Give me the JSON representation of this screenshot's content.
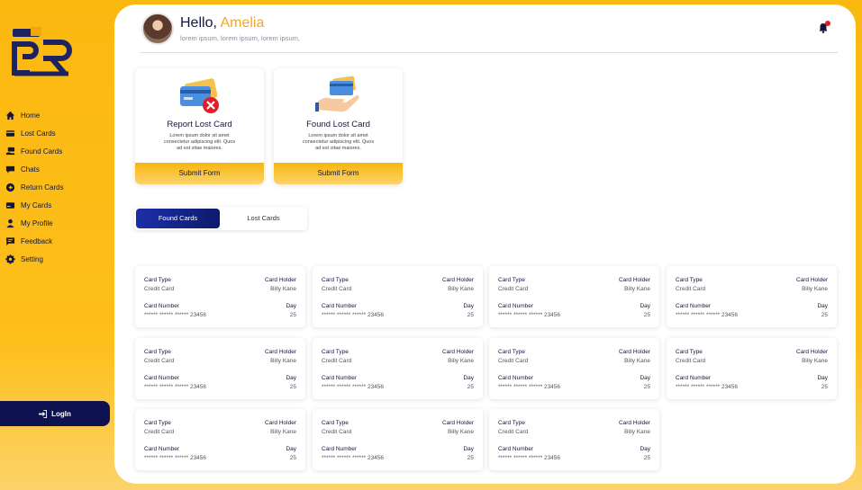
{
  "sidebar": {
    "items": [
      {
        "label": "Home",
        "icon": "home-icon"
      },
      {
        "label": "Lost Cards",
        "icon": "card-icon"
      },
      {
        "label": "Found Cards",
        "icon": "found-card-icon"
      },
      {
        "label": "Chats",
        "icon": "chat-icon"
      },
      {
        "label": "Return Cards",
        "icon": "return-icon"
      },
      {
        "label": "My Cards",
        "icon": "wallet-icon"
      },
      {
        "label": "My Profile",
        "icon": "user-icon"
      },
      {
        "label": "Feedback",
        "icon": "feedback-icon"
      },
      {
        "label": "Setting",
        "icon": "gear-icon"
      }
    ],
    "login_label": "LogIn"
  },
  "header": {
    "greeting": "Hello, ",
    "name": "Amelia",
    "subtitle": "lorem ipsum, lorem ipsum, lorem ipsum,"
  },
  "actions": [
    {
      "title": "Report Lost Card",
      "desc": "Lorem ipsum dolor sit amet consectetur adipiscing elit. Quos ad est vitae maiores.",
      "button": "Submit Form"
    },
    {
      "title": "Found Lost Card",
      "desc": "Lorem ipsum dolor sit amet consectetur adipiscing elit. Quos ad est vitae maiores.",
      "button": "Submit Form"
    }
  ],
  "tabs": [
    "Found Cards",
    "Lost Cards"
  ],
  "card_labels": {
    "type": "Card Type",
    "holder": "Card Holder",
    "number": "Card Number",
    "day": "Day"
  },
  "cards": [
    {
      "type": "Credit Card",
      "holder": "Billy Kane",
      "number": "****** ****** ****** 23456",
      "day": "25"
    },
    {
      "type": "Credit Card",
      "holder": "Billy Kane",
      "number": "****** ****** ****** 23456",
      "day": "25"
    },
    {
      "type": "Credit Card",
      "holder": "Billy Kane",
      "number": "****** ****** ****** 23456",
      "day": "25"
    },
    {
      "type": "Credit Card",
      "holder": "Billy Kane",
      "number": "****** ****** ****** 23456",
      "day": "25"
    },
    {
      "type": "Credit Card",
      "holder": "Billy Kane",
      "number": "****** ****** ****** 23456",
      "day": "25"
    },
    {
      "type": "Credit Card",
      "holder": "Billy Kane",
      "number": "****** ****** ****** 23456",
      "day": "25"
    },
    {
      "type": "Credit Card",
      "holder": "Billy Kane",
      "number": "****** ****** ****** 23456",
      "day": "25"
    },
    {
      "type": "Credit Card",
      "holder": "Billy Kane",
      "number": "****** ****** ****** 23456",
      "day": "25"
    },
    {
      "type": "Credit Card",
      "holder": "Billy Kane",
      "number": "****** ****** ****** 23456",
      "day": "25"
    },
    {
      "type": "Credit Card",
      "holder": "Billy Kane",
      "number": "****** ****** ****** 23456",
      "day": "25"
    },
    {
      "type": "Credit Card",
      "holder": "Billy Kane",
      "number": "****** ****** ****** 23456",
      "day": "25"
    }
  ],
  "colors": {
    "accent": "#fbb80f",
    "navy": "#0f1251",
    "name": "#f5a623"
  }
}
